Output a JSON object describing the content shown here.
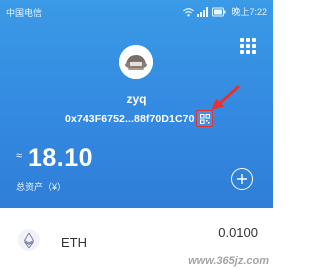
{
  "status_bar": {
    "carrier": "中国电信",
    "time": "晚上7:22",
    "icons": [
      "wifi-icon",
      "signal-icon",
      "battery-icon"
    ]
  },
  "header": {
    "menu_icon": "grid-menu-icon",
    "avatar_icon": "avatar-image",
    "account_name": "zyq",
    "address": "0x743F6752...88f70D1C70",
    "qr_icon": "qr-code-icon",
    "approx_sign": "≈",
    "balance": "18.10",
    "total_label": "总资产（¥）",
    "add_icon": "plus-icon"
  },
  "assets": [
    {
      "symbol": "ETH",
      "amount": "0.0100",
      "icon": "ethereum-icon"
    }
  ],
  "annotation": {
    "color": "#e8312f"
  },
  "theme": {
    "header_blue": "#3489e0",
    "white": "#ffffff"
  },
  "watermark": "www.365jz.com"
}
